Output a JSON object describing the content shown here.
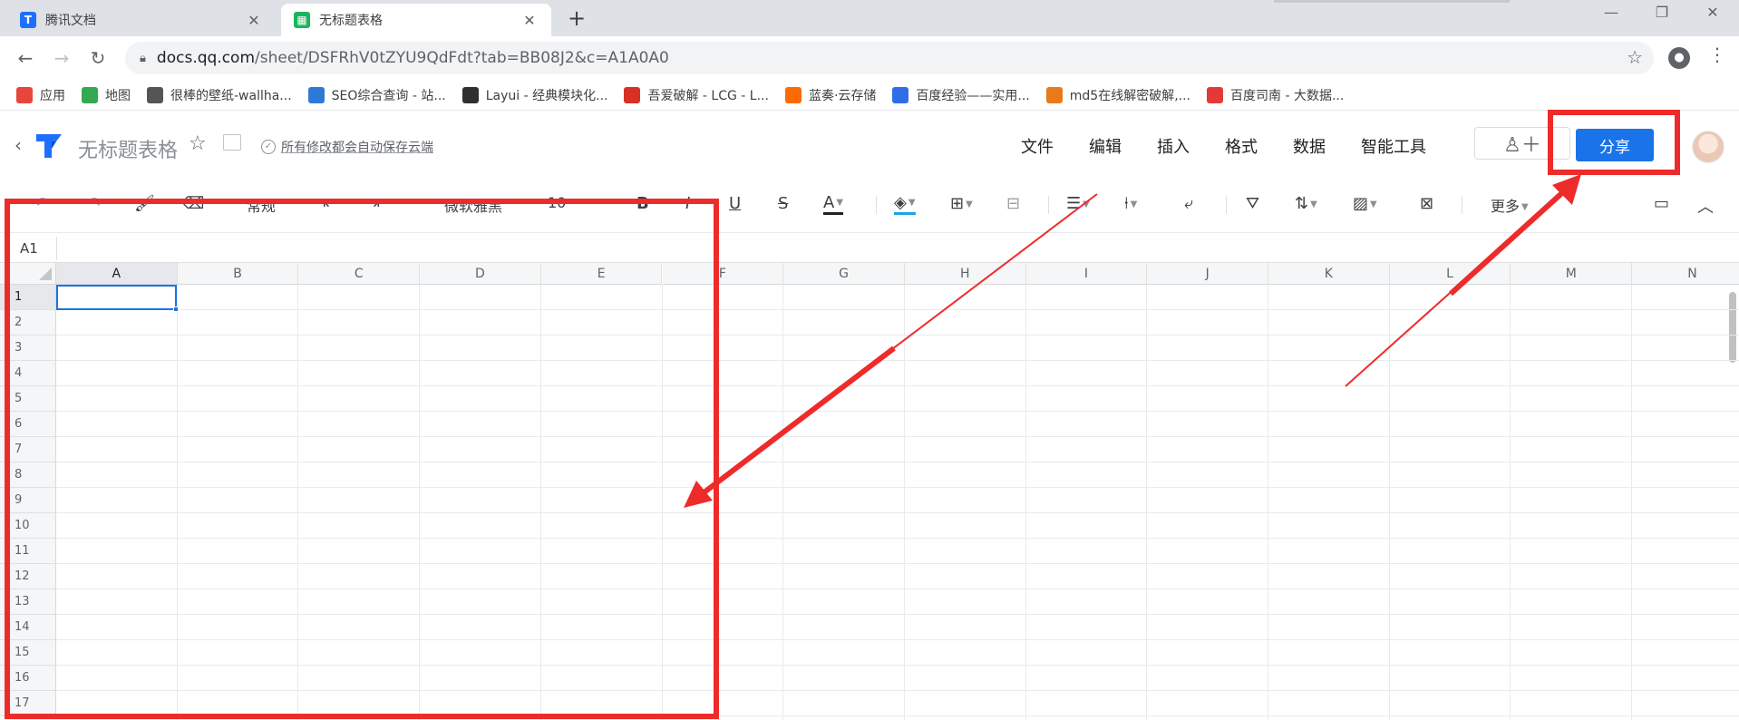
{
  "browser": {
    "tabs": [
      {
        "title": "腾讯文档",
        "icon": "tencent-docs-icon",
        "active": false
      },
      {
        "title": "无标题表格",
        "icon": "tencent-sheet-icon",
        "active": true
      }
    ],
    "address": {
      "domain": "docs.qq.com",
      "path": "/sheet/DSFRhV0tZYU9QdFdt?tab=BB08J2&c=A1A0A0"
    },
    "bookmarks": [
      {
        "label": "应用",
        "icon": "apps-grid-icon",
        "color": "#e8453c"
      },
      {
        "label": "地图",
        "icon": "maps-icon",
        "color": "#34a853"
      },
      {
        "label": "很棒的壁纸-wallha...",
        "icon": "wallhaven-icon",
        "color": "#555555"
      },
      {
        "label": "SEO综合查询 - 站...",
        "icon": "seo-icon",
        "color": "#2b7bd6"
      },
      {
        "label": "Layui - 经典模块化...",
        "icon": "layui-icon",
        "color": "#2f2f2f"
      },
      {
        "label": "吾爱破解 - LCG - L...",
        "icon": "52pojie-icon",
        "color": "#d93025"
      },
      {
        "label": "蓝奏·云存储",
        "icon": "lanzou-icon",
        "color": "#ff6a00"
      },
      {
        "label": "百度经验——实用...",
        "icon": "baidu-paw-icon",
        "color": "#2f6fe6"
      },
      {
        "label": "md5在线解密破解,...",
        "icon": "cmd5-icon",
        "color": "#e87a1c"
      },
      {
        "label": "百度司南 - 大数据...",
        "icon": "baidu-sinan-icon",
        "color": "#e53935"
      }
    ]
  },
  "doc": {
    "title": "无标题表格",
    "save_status": "所有修改都会自动保存云端",
    "menus": [
      "文件",
      "编辑",
      "插入",
      "格式",
      "数据",
      "智能工具"
    ],
    "share_label": "分享",
    "brand_color": "#1a73e8"
  },
  "toolbar": {
    "number_format": "常规",
    "font_name": "微软雅黑",
    "font_size": "10",
    "more_label": "更多"
  },
  "formula_bar": {
    "cell_ref": "A1"
  },
  "sheet": {
    "columns": [
      "A",
      "B",
      "C",
      "D",
      "E",
      "F",
      "G",
      "H",
      "I",
      "J",
      "K",
      "L",
      "M",
      "N"
    ],
    "rows": [
      "1",
      "2",
      "3",
      "4",
      "5",
      "6",
      "7",
      "8",
      "9",
      "10",
      "11",
      "12",
      "13",
      "14",
      "15",
      "16",
      "17"
    ],
    "selected_cell": "A1"
  },
  "annotations": {
    "color": "#ee2b2b"
  }
}
